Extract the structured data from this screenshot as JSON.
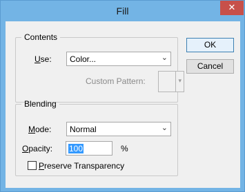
{
  "window": {
    "title": "Fill",
    "close_glyph": "✕"
  },
  "contents": {
    "legend": "Contents",
    "use_label": {
      "access_key": "U",
      "rest": "se:"
    },
    "use_value": "Color...",
    "custom_pattern_label": "Custom Pattern:"
  },
  "blending": {
    "legend": "Blending",
    "mode_label": {
      "access_key": "M",
      "rest": "ode:"
    },
    "mode_value": "Normal",
    "opacity_label": {
      "access_key": "O",
      "rest": "pacity:"
    },
    "opacity_value": "100",
    "opacity_unit": "%",
    "preserve_label": {
      "access_key": "P",
      "rest": "reserve Transparency"
    },
    "preserve_checked": false
  },
  "buttons": {
    "ok": "OK",
    "cancel": "Cancel"
  },
  "icons": {
    "dropdown": "chevron-down-icon",
    "close": "close-icon"
  }
}
